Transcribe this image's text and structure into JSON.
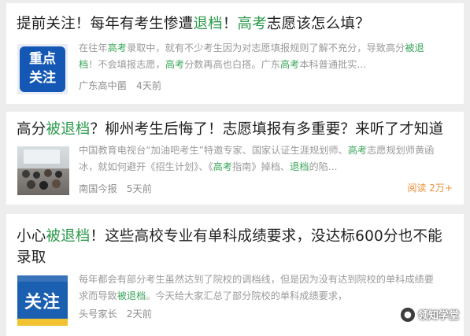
{
  "articles": [
    {
      "title_parts": [
        {
          "text": "提前关注！每年有考生惨遭",
          "hl": false
        },
        {
          "text": "退档",
          "hl": true
        },
        {
          "text": "！",
          "hl": false
        },
        {
          "text": "高考",
          "hl": true
        },
        {
          "text": "志愿该怎么填？",
          "hl": false
        }
      ],
      "snippet_parts": [
        {
          "text": "在往年",
          "hl": false
        },
        {
          "text": "高考",
          "hl": true
        },
        {
          "text": "录取中，就有不少考生因为对志愿填报规则了解不充分，导致高分",
          "hl": false
        },
        {
          "text": "被退档",
          "hl": true
        },
        {
          "text": "！不会填报志愿，",
          "hl": false
        },
        {
          "text": "高考",
          "hl": true
        },
        {
          "text": "分数再高也白搭。广东",
          "hl": false
        },
        {
          "text": "高考",
          "hl": true
        },
        {
          "text": "本科普通批实...",
          "hl": false
        }
      ],
      "thumb_text": [
        "重点",
        "关注"
      ],
      "source": "广东高中菌",
      "time": "4天前",
      "reads": ""
    },
    {
      "title_parts": [
        {
          "text": "高分",
          "hl": false
        },
        {
          "text": "被退档",
          "hl": true
        },
        {
          "text": "？柳州考生后悔了！志愿填报有多重要？来听了才知道",
          "hl": false
        }
      ],
      "snippet_parts": [
        {
          "text": "中国教育电视台“加油吧考生”特邀专家、国家认证生涯规划师、",
          "hl": false
        },
        {
          "text": "高考",
          "hl": true
        },
        {
          "text": "志愿规划师黄函冰，就如何避开《招生计划》、《",
          "hl": false
        },
        {
          "text": "高考",
          "hl": true
        },
        {
          "text": "指南》掉档、",
          "hl": false
        },
        {
          "text": "退档",
          "hl": true
        },
        {
          "text": "的陷...",
          "hl": false
        }
      ],
      "source": "南国今报",
      "time": "5天前",
      "reads": "阅读 2万+"
    },
    {
      "title_parts": [
        {
          "text": "小心",
          "hl": false
        },
        {
          "text": "被退档",
          "hl": true
        },
        {
          "text": "！这些高校专业有单科成绩要求，没达标600分也不能录取",
          "hl": false
        }
      ],
      "snippet_parts": [
        {
          "text": "每年都会有部分考生虽然达到了院校的调档线，但是因为没有达到院校的单科成绩要求而导致",
          "hl": false
        },
        {
          "text": "被退档",
          "hl": true
        },
        {
          "text": "。今天给大家汇总了部分院校的单科成绩要求，",
          "hl": false
        }
      ],
      "thumb_text": "关注",
      "source": "头号家长",
      "time": "2天前",
      "reads": ""
    }
  ],
  "watermark": "领知学堂",
  "colors": {
    "highlight": "#2b9a4b",
    "reads": "#e8913a"
  }
}
